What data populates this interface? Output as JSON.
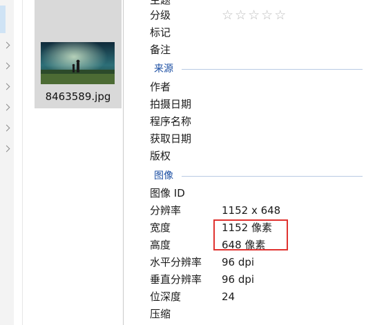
{
  "explorer": {
    "file_name": "8463589.jpg"
  },
  "properties": {
    "partial_top_label": "主题",
    "rating": {
      "label": "分级",
      "stars": 5,
      "filled": 0
    },
    "rows_basic": [
      {
        "label": "标记",
        "value": ""
      },
      {
        "label": "备注",
        "value": ""
      }
    ],
    "section_source": "来源",
    "rows_source": [
      {
        "label": "作者",
        "value": ""
      },
      {
        "label": "拍摄日期",
        "value": ""
      },
      {
        "label": "程序名称",
        "value": ""
      },
      {
        "label": "获取日期",
        "value": ""
      },
      {
        "label": "版权",
        "value": ""
      }
    ],
    "section_image": "图像",
    "rows_image": [
      {
        "label": "图像 ID",
        "value": ""
      },
      {
        "label": "分辨率",
        "value": "1152 x 648"
      },
      {
        "label": "宽度",
        "value": "1152 像素"
      },
      {
        "label": "高度",
        "value": "648 像素"
      },
      {
        "label": "水平分辨率",
        "value": "96 dpi"
      },
      {
        "label": "垂直分辨率",
        "value": "96 dpi"
      },
      {
        "label": "位深度",
        "value": "24"
      }
    ],
    "partial_bottom_label": "压缩"
  },
  "colors": {
    "section_header": "#1c4fa3",
    "highlight_box": "#e0312e"
  }
}
